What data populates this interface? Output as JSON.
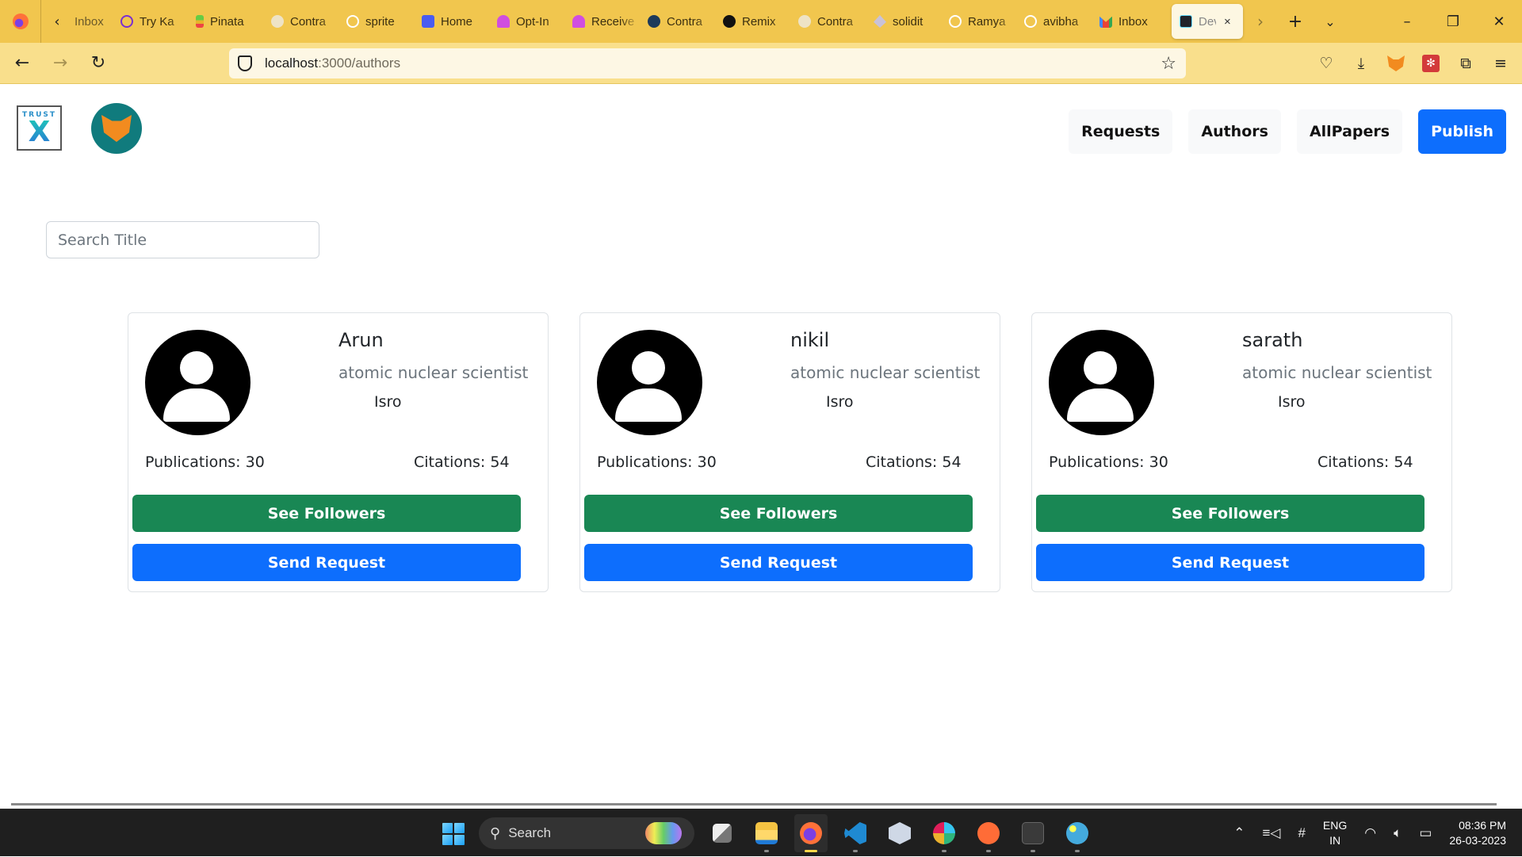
{
  "browser": {
    "tabs": [
      {
        "label": "Inbox",
        "icon": "gmail-icon",
        "color": "#d93025"
      },
      {
        "label": "Try Ka",
        "icon": "openai-icon",
        "color": "#7b2fd0"
      },
      {
        "label": "Pinata",
        "icon": "pinata-icon",
        "color": "#e8b42a"
      },
      {
        "label": "Contra",
        "icon": "contract-icon",
        "color": "#e8e0c8"
      },
      {
        "label": "sprite",
        "icon": "github-icon",
        "color": "#ffffff"
      },
      {
        "label": "Home",
        "icon": "app-icon",
        "color": "#4a5cf0"
      },
      {
        "label": "Opt-In",
        "icon": "bell-icon",
        "color": "#d04ee0"
      },
      {
        "label": "Receive",
        "icon": "bell-icon",
        "color": "#d04ee0"
      },
      {
        "label": "Contra",
        "icon": "contract-dark-icon",
        "color": "#1d3a5a"
      },
      {
        "label": "Remix",
        "icon": "remix-icon",
        "color": "#111111"
      },
      {
        "label": "Contra",
        "icon": "contract-icon",
        "color": "#e8e0c8"
      },
      {
        "label": "solidit",
        "icon": "ethereum-icon",
        "color": "#c9c2d8"
      },
      {
        "label": "Ramya",
        "icon": "github-icon",
        "color": "#ffffff"
      },
      {
        "label": "avibha",
        "icon": "github-icon",
        "color": "#ffffff"
      },
      {
        "label": "Inbox",
        "icon": "gmail-icon",
        "color": "#d93025"
      }
    ],
    "active_tab": {
      "label": "Dev",
      "icon": "react-icon",
      "close": "×"
    },
    "url_host": "localhost",
    "url_rest": ":3000/authors"
  },
  "header": {
    "logo_text_top": "TRUST",
    "logo_text_main": "X",
    "nav": [
      {
        "label": "Requests"
      },
      {
        "label": "Authors"
      },
      {
        "label": "AllPapers"
      },
      {
        "label": "Publish"
      }
    ]
  },
  "search": {
    "placeholder": "Search Title",
    "value": ""
  },
  "authors": [
    {
      "name": "Arun",
      "role": "atomic nuclear scientist",
      "org": "Isro",
      "publications": "Publications: 30",
      "citations": "Citations: 54",
      "followers_label": "See Followers",
      "request_label": "Send Request"
    },
    {
      "name": "nikil",
      "role": "atomic nuclear scientist",
      "org": "Isro",
      "publications": "Publications: 30",
      "citations": "Citations: 54",
      "followers_label": "See Followers",
      "request_label": "Send Request"
    },
    {
      "name": "sarath",
      "role": "atomic nuclear scientist",
      "org": "Isro",
      "publications": "Publications: 30",
      "citations": "Citations: 54",
      "followers_label": "See Followers",
      "request_label": "Send Request"
    }
  ],
  "colors": {
    "primary": "#0d6efd",
    "success": "#198754",
    "tabstrip": "#f1c64e",
    "navbar": "#f9df8c"
  },
  "taskbar": {
    "search_label": "Search",
    "lang_1": "ENG",
    "lang_2": "IN",
    "time": "08:36 PM",
    "date": "26-03-2023"
  }
}
